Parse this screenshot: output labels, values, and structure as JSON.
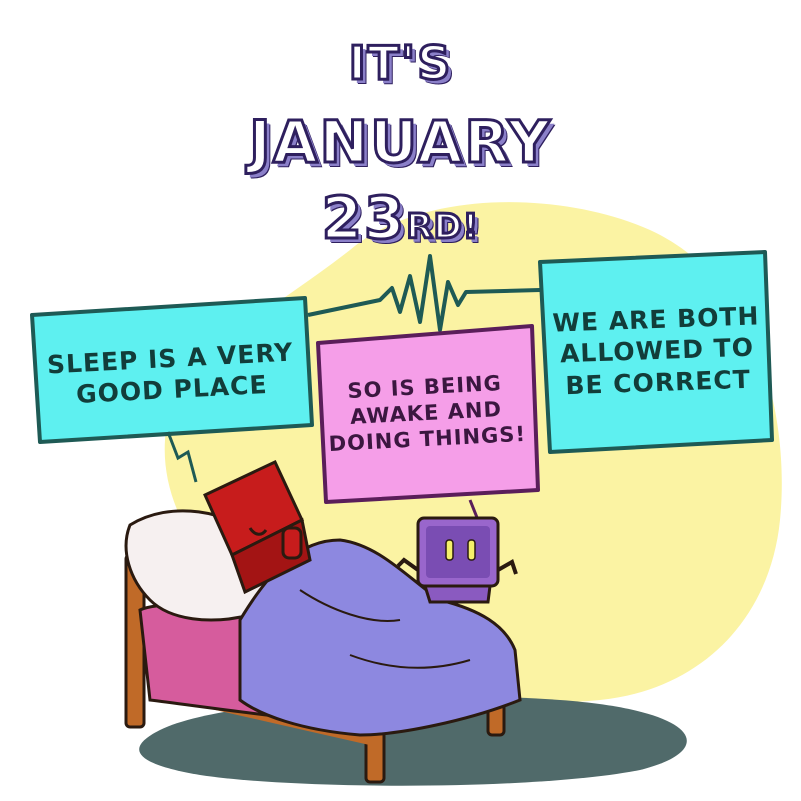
{
  "title": {
    "line1": "IT'S",
    "line2": "JANUARY",
    "line3_number": "23",
    "line3_suffix": "RD!"
  },
  "bubbles": {
    "left": "SLEEP IS A VERY GOOD PLACE",
    "middle": "SO IS BEING AWAKE AND DOING THINGS!",
    "right": "WE ARE BOTH ALLOWED TO BE CORRECT"
  },
  "colors": {
    "title_outline": "#2e1f5e",
    "title_shadow": "#8b80c9",
    "bubble_cyan": "#5ef0f0",
    "bubble_pink": "#f59ee8",
    "bubble_border": "#1e5a55",
    "background_blob": "#fbf3a3",
    "red_robot": "#c71c1c",
    "purple_robot": "#9966cc",
    "blanket": "#8d88e0",
    "sheet": "#d65c9d",
    "bed_frame": "#c06a28",
    "floor_shadow": "#506a6a"
  }
}
